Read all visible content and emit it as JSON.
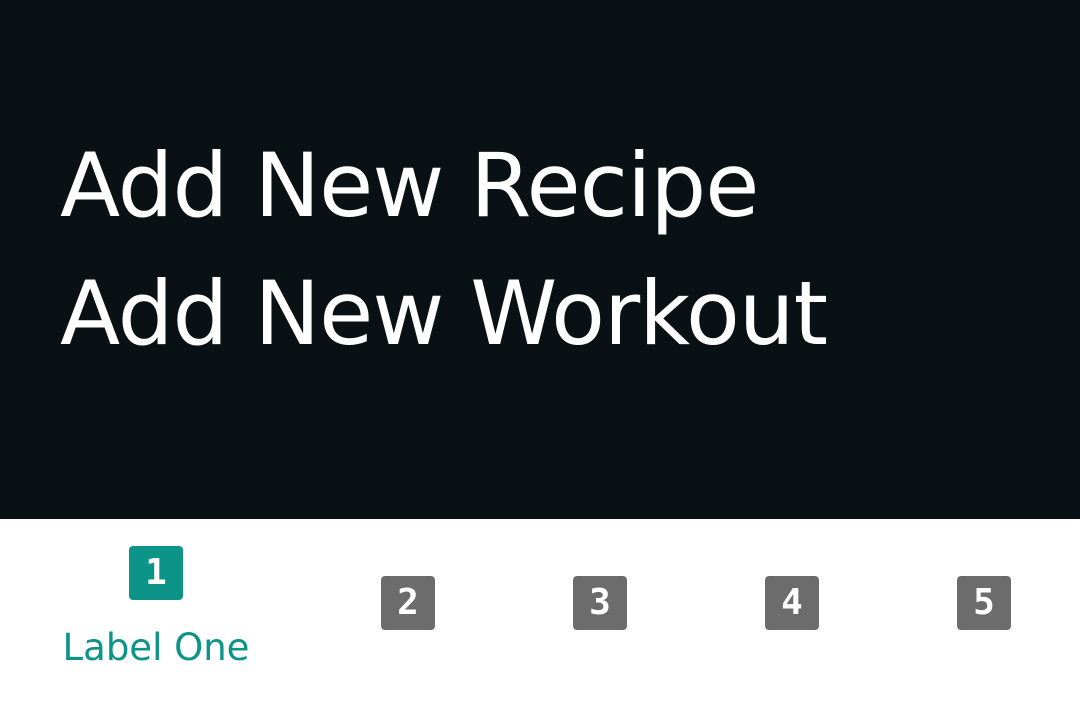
{
  "content": {
    "actions": [
      {
        "label": "Add New Recipe"
      },
      {
        "label": "Add New Workout"
      }
    ]
  },
  "bottom_nav": {
    "items": [
      {
        "number": "1",
        "label": "Label One",
        "active": true
      },
      {
        "number": "2",
        "active": false
      },
      {
        "number": "3",
        "active": false
      },
      {
        "number": "4",
        "active": false
      },
      {
        "number": "5",
        "active": false
      }
    ]
  },
  "colors": {
    "content_background": "#0a1115",
    "active_accent": "#0d9488",
    "inactive_badge": "#6c6c6c",
    "nav_background": "#ffffff"
  },
  "icons": {
    "nav_item_icons": [
      "number-1-icon",
      "number-2-icon",
      "number-3-icon",
      "number-4-icon",
      "number-5-icon"
    ]
  }
}
